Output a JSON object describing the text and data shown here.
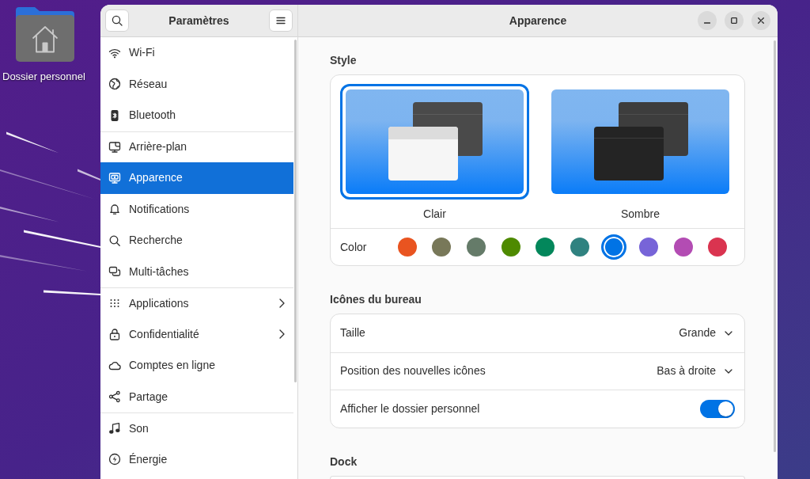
{
  "desktop": {
    "icons": [
      {
        "label": "Dossier personnel"
      }
    ]
  },
  "sidebar": {
    "title": "Paramètres",
    "groups": [
      {
        "items": [
          {
            "label": "Wi-Fi",
            "selected": false,
            "submenu": false
          },
          {
            "label": "Réseau",
            "selected": false,
            "submenu": false
          },
          {
            "label": "Bluetooth",
            "selected": false,
            "submenu": false
          }
        ]
      },
      {
        "items": [
          {
            "label": "Arrière-plan",
            "selected": false,
            "submenu": false
          },
          {
            "label": "Apparence",
            "selected": true,
            "submenu": false
          },
          {
            "label": "Notifications",
            "selected": false,
            "submenu": false
          },
          {
            "label": "Recherche",
            "selected": false,
            "submenu": false
          },
          {
            "label": "Multi-tâches",
            "selected": false,
            "submenu": false
          }
        ]
      },
      {
        "items": [
          {
            "label": "Applications",
            "selected": false,
            "submenu": true
          },
          {
            "label": "Confidentialité",
            "selected": false,
            "submenu": true
          },
          {
            "label": "Comptes en ligne",
            "selected": false,
            "submenu": false
          },
          {
            "label": "Partage",
            "selected": false,
            "submenu": false
          }
        ]
      },
      {
        "items": [
          {
            "label": "Son",
            "selected": false,
            "submenu": false
          },
          {
            "label": "Énergie",
            "selected": false,
            "submenu": false
          }
        ]
      }
    ]
  },
  "page": {
    "title": "Apparence",
    "sections": [
      {
        "heading": "Style",
        "styles": [
          {
            "kind": "light",
            "label": "Clair",
            "selected": true
          },
          {
            "kind": "dark",
            "label": "Sombre",
            "selected": false
          }
        ],
        "color_label": "Color",
        "accents": [
          {
            "color": "#e95420",
            "selected": false
          },
          {
            "color": "#787859",
            "selected": false
          },
          {
            "color": "#657b69",
            "selected": false
          },
          {
            "color": "#4e8a00",
            "selected": false
          },
          {
            "color": "#03875b",
            "selected": false
          },
          {
            "color": "#308280",
            "selected": false
          },
          {
            "color": "#0073e5",
            "selected": true
          },
          {
            "color": "#7764d8",
            "selected": false
          },
          {
            "color": "#b34cb3",
            "selected": false
          },
          {
            "color": "#da3450",
            "selected": false
          }
        ]
      },
      {
        "heading": "Icônes du bureau",
        "rows": [
          {
            "kind": "dropdown",
            "label": "Taille",
            "value": "Grande"
          },
          {
            "kind": "dropdown",
            "label": "Position des nouvelles icônes",
            "value": "Bas à droite"
          },
          {
            "kind": "switch",
            "label": "Afficher le dossier personnel",
            "on": true
          }
        ]
      },
      {
        "heading": "Dock"
      }
    ]
  }
}
